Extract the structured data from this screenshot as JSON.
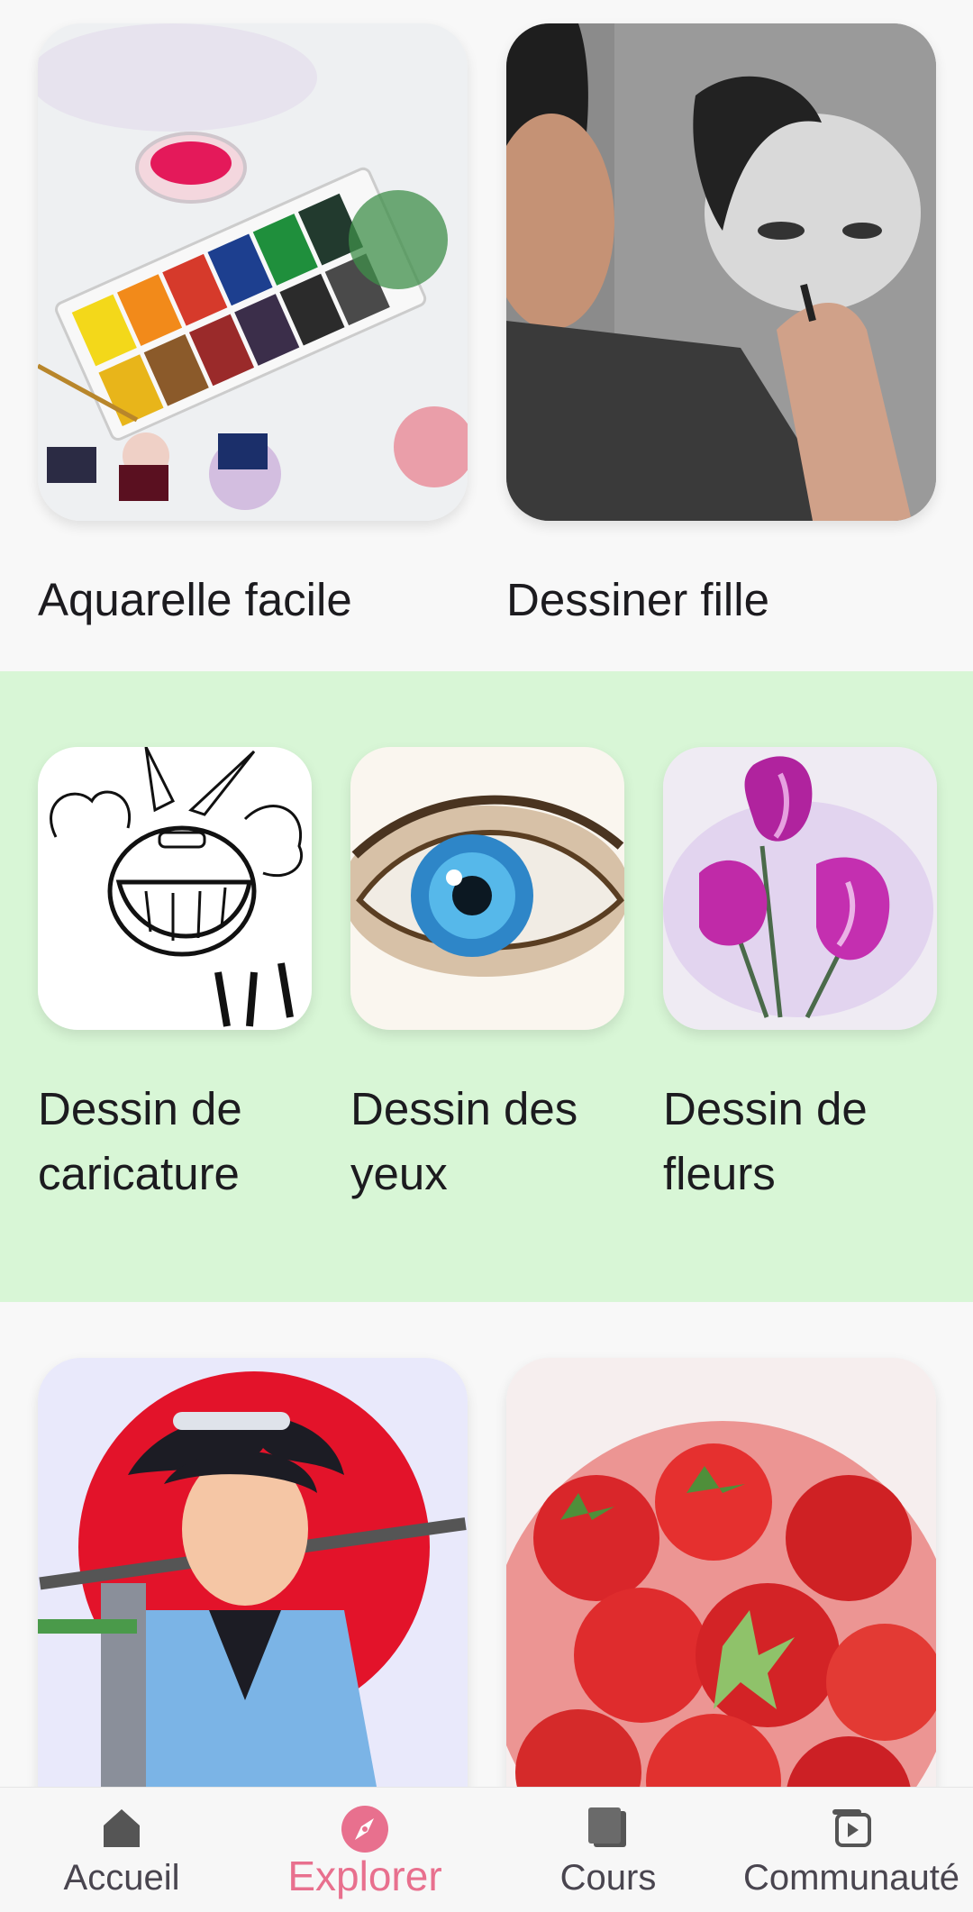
{
  "cards_top": [
    {
      "label": "Aquarelle facile"
    },
    {
      "label": "Dessiner fille"
    }
  ],
  "cards_middle": [
    {
      "label_line1": "Dessin de",
      "label_line2": "caricature"
    },
    {
      "label_line1": "Dessin des",
      "label_line2": "yeux"
    },
    {
      "label_line1": "Dessin de",
      "label_line2": "fleurs"
    }
  ],
  "bottom_nav": {
    "items": [
      {
        "label": "Accueil",
        "icon": "home-icon"
      },
      {
        "label": "Explorer",
        "icon": "compass-icon"
      },
      {
        "label": "Cours",
        "icon": "book-icon"
      },
      {
        "label": "Communauté",
        "icon": "video-icon"
      }
    ],
    "active_index": 1
  },
  "colors": {
    "background": "#f8f8f8",
    "band": "#d8f6d6",
    "accent": "#e8708e",
    "text": "#1c1b1f",
    "nav_text": "#49454f"
  }
}
